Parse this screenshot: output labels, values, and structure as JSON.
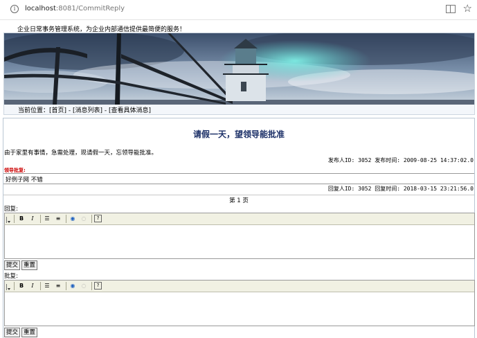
{
  "browser": {
    "url_host": "localhost",
    "url_path": ":8081/CommitReply"
  },
  "header": {
    "slogan": "企业日常事务管理系统，为企业内部通信提供最简便的服务！",
    "breadcrumb": "当前位置：[首页] - [消息列表] - [查看具体消息]"
  },
  "message": {
    "title": "请假一天，望领导能批准",
    "content": "由于家里有事情，急需处理，现请假一天，忘领导能批准。",
    "meta": "发布人ID: 3052 发布时间: 2009-08-25 14:37:02.0"
  },
  "leader_label": "领导批复:",
  "reply": {
    "text": "好例子网 不错",
    "meta": "回复人ID: 3052 回复时间: 2018-03-15 23:21:56.0"
  },
  "pagination": "第 1 页",
  "reply_form": {
    "label": "回复:",
    "submit": "提交",
    "reset": "重置"
  },
  "approve_form": {
    "label": "批复:",
    "submit": "提交",
    "reset": "重置"
  },
  "toolbar_icons": [
    "bold-icon",
    "italic-icon",
    "ordered-list-icon",
    "unordered-list-icon",
    "link-icon",
    "unlink-icon",
    "help-icon"
  ]
}
